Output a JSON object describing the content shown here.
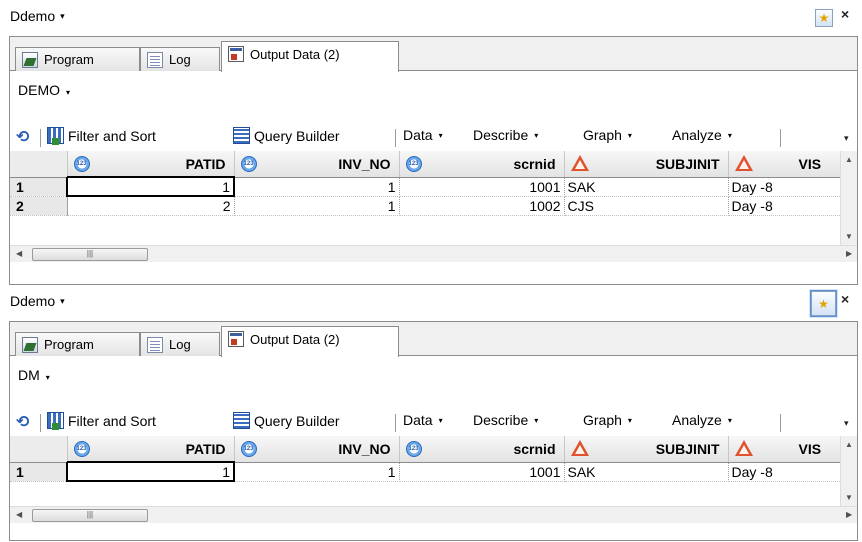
{
  "panes": [
    {
      "title": "Ddemo",
      "tabs": [
        "Program",
        "Log",
        "Output Data (2)"
      ],
      "dataset": "DEMO",
      "toolbar": {
        "filter_sort": "Filter and Sort",
        "query_builder": "Query Builder",
        "data": "Data",
        "describe": "Describe",
        "graph": "Graph",
        "analyze": "Analyze"
      },
      "columns": [
        "PATID",
        "INV_NO",
        "scrnid",
        "SUBJINIT",
        "VIS"
      ],
      "rows": [
        {
          "rownum": "1",
          "PATID": "1",
          "INV_NO": "1",
          "scrnid": "1001",
          "SUBJINIT": "SAK",
          "VIS": "Day -8"
        },
        {
          "rownum": "2",
          "PATID": "2",
          "INV_NO": "1",
          "scrnid": "1002",
          "SUBJINIT": "CJS",
          "VIS": "Day -8"
        }
      ]
    },
    {
      "title": "Ddemo",
      "tabs": [
        "Program",
        "Log",
        "Output Data (2)"
      ],
      "dataset": "DM",
      "toolbar": {
        "filter_sort": "Filter and Sort",
        "query_builder": "Query Builder",
        "data": "Data",
        "describe": "Describe",
        "graph": "Graph",
        "analyze": "Analyze"
      },
      "columns": [
        "PATID",
        "INV_NO",
        "scrnid",
        "SUBJINIT",
        "VIS"
      ],
      "rows": [
        {
          "rownum": "1",
          "PATID": "1",
          "INV_NO": "1",
          "scrnid": "1001",
          "SUBJINIT": "SAK",
          "VIS": "Day -8"
        }
      ]
    }
  ],
  "icons": {
    "dropdown": "chevron-down-icon",
    "pin": "pin-window-icon",
    "close": "close-icon",
    "refresh": "refresh-icon",
    "numeric_col": "numeric-column-icon",
    "char_col": "character-column-icon"
  },
  "glyphs": {
    "dd": "▾",
    "star": "★",
    "close": "×",
    "refresh": "⟲",
    "col_num": "123",
    "up": "▲",
    "down": "▼",
    "left": "◀",
    "right": "▶",
    "grip": "|||",
    "overflow": "▾"
  }
}
